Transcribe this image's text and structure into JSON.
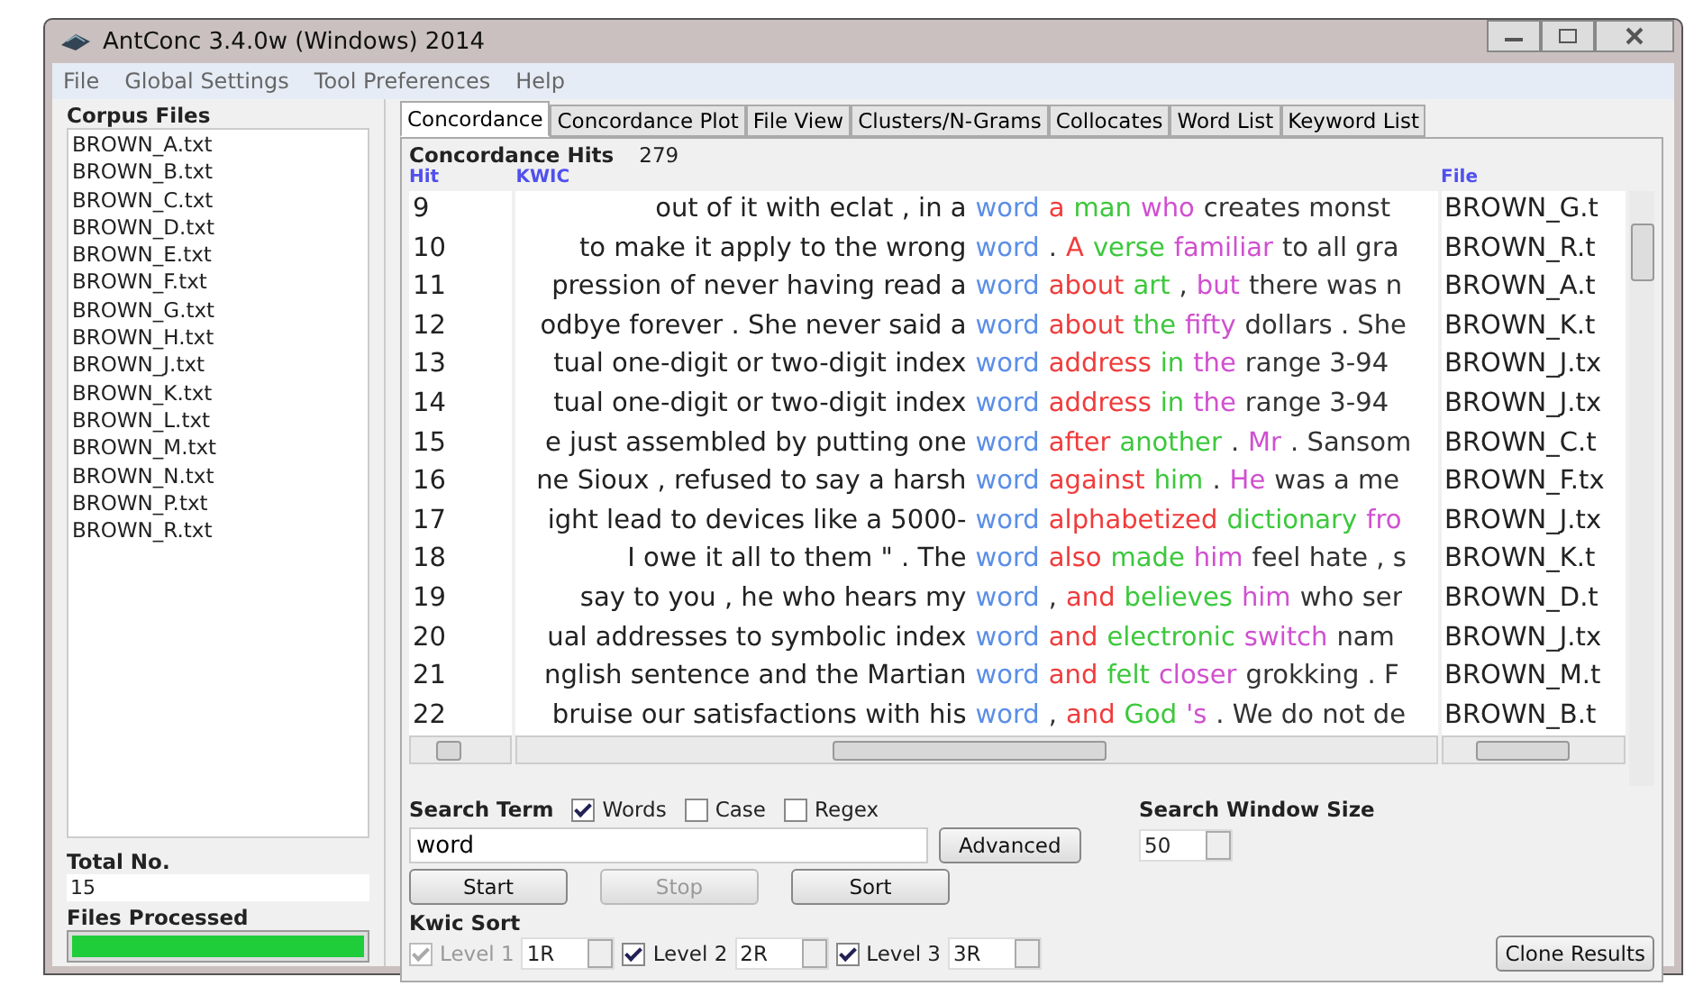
{
  "window": {
    "title": "AntConc 3.4.0w (Windows) 2014"
  },
  "menu": [
    "File",
    "Global Settings",
    "Tool Preferences",
    "Help"
  ],
  "corpus": {
    "title": "Corpus Files",
    "files": [
      "BROWN_A.txt",
      "BROWN_B.txt",
      "BROWN_C.txt",
      "BROWN_D.txt",
      "BROWN_E.txt",
      "BROWN_F.txt",
      "BROWN_G.txt",
      "BROWN_H.txt",
      "BROWN_J.txt",
      "BROWN_K.txt",
      "BROWN_L.txt",
      "BROWN_M.txt",
      "BROWN_N.txt",
      "BROWN_P.txt",
      "BROWN_R.txt"
    ],
    "total_label": "Total No.",
    "total": "15",
    "processed_label": "Files Processed",
    "level": 1
  },
  "tabs": [
    {
      "label": "Concordance",
      "selected": true
    },
    {
      "label": "Concordance Plot",
      "selected": false
    },
    {
      "label": "File View",
      "selected": false
    },
    {
      "label": "Clusters/N-Grams",
      "selected": false
    },
    {
      "label": "Collocates",
      "selected": false
    },
    {
      "label": "Word List",
      "selected": false
    },
    {
      "label": "Keyword List",
      "selected": false
    }
  ],
  "hits": {
    "label": "Concordance Hits",
    "count": "279"
  },
  "columns": [
    "Hit",
    "KWIC",
    "File"
  ],
  "rows": [
    {
      "hit": "9",
      "left": "out of it with eclat , in a",
      "keyword": {
        "text": "word",
        "color": "#5b8ee6"
      },
      "right": [
        {
          "text": "a",
          "color": "#f03c3c"
        },
        {
          "text": "man",
          "color": "#3cc83c"
        },
        {
          "text": "who",
          "color": "#d050d0"
        },
        {
          "text": "creates monst",
          "color": "#333333"
        }
      ],
      "file": "BROWN_G.t"
    },
    {
      "hit": "10",
      "left": "to make it apply to the wrong",
      "keyword": {
        "text": "word",
        "color": "#5b8ee6"
      },
      "right": [
        {
          "text": ".",
          "color": "#333333"
        },
        {
          "text": "A",
          "color": "#f03c3c"
        },
        {
          "text": "verse",
          "color": "#3cc83c"
        },
        {
          "text": "familiar",
          "color": "#d050d0"
        },
        {
          "text": "to all gra",
          "color": "#333333"
        }
      ],
      "file": "BROWN_R.t"
    },
    {
      "hit": "11",
      "left": "pression of never having read a",
      "keyword": {
        "text": "word",
        "color": "#5b8ee6"
      },
      "right": [
        {
          "text": "about",
          "color": "#f03c3c"
        },
        {
          "text": "art",
          "color": "#3cc83c"
        },
        {
          "text": ",",
          "color": "#333333"
        },
        {
          "text": "but",
          "color": "#d050d0"
        },
        {
          "text": "there was n",
          "color": "#333333"
        }
      ],
      "file": "BROWN_A.t"
    },
    {
      "hit": "12",
      "left": "odbye forever . She never said a",
      "keyword": {
        "text": "word",
        "color": "#5b8ee6"
      },
      "right": [
        {
          "text": "about",
          "color": "#f03c3c"
        },
        {
          "text": "the",
          "color": "#3cc83c"
        },
        {
          "text": "fifty",
          "color": "#d050d0"
        },
        {
          "text": "dollars . She",
          "color": "#333333"
        }
      ],
      "file": "BROWN_K.t"
    },
    {
      "hit": "13",
      "left": "tual one-digit or two-digit index",
      "keyword": {
        "text": "word",
        "color": "#5b8ee6"
      },
      "right": [
        {
          "text": "address",
          "color": "#f03c3c"
        },
        {
          "text": "in",
          "color": "#3cc83c"
        },
        {
          "text": "the",
          "color": "#d050d0"
        },
        {
          "text": "range 3-94",
          "color": "#333333"
        }
      ],
      "file": "BROWN_J.tx"
    },
    {
      "hit": "14",
      "left": "tual one-digit or two-digit index",
      "keyword": {
        "text": "word",
        "color": "#5b8ee6"
      },
      "right": [
        {
          "text": "address",
          "color": "#f03c3c"
        },
        {
          "text": "in",
          "color": "#3cc83c"
        },
        {
          "text": "the",
          "color": "#d050d0"
        },
        {
          "text": "range 3-94",
          "color": "#333333"
        }
      ],
      "file": "BROWN_J.tx"
    },
    {
      "hit": "15",
      "left": "e just assembled by putting one",
      "keyword": {
        "text": "word",
        "color": "#5b8ee6"
      },
      "right": [
        {
          "text": "after",
          "color": "#f03c3c"
        },
        {
          "text": "another",
          "color": "#3cc83c"
        },
        {
          "text": ".",
          "color": "#333333"
        },
        {
          "text": "Mr",
          "color": "#d050d0"
        },
        {
          "text": ". Sansom",
          "color": "#333333"
        }
      ],
      "file": "BROWN_C.t"
    },
    {
      "hit": "16",
      "left": "ne Sioux , refused to say a harsh",
      "keyword": {
        "text": "word",
        "color": "#5b8ee6"
      },
      "right": [
        {
          "text": "against",
          "color": "#f03c3c"
        },
        {
          "text": "him",
          "color": "#3cc83c"
        },
        {
          "text": ".",
          "color": "#333333"
        },
        {
          "text": "He",
          "color": "#d050d0"
        },
        {
          "text": "was a me",
          "color": "#333333"
        }
      ],
      "file": "BROWN_F.tx"
    },
    {
      "hit": "17",
      "left": "ight lead to devices like a 5000-",
      "keyword": {
        "text": "word",
        "color": "#5b8ee6"
      },
      "right": [
        {
          "text": "alphabetized",
          "color": "#f03c3c"
        },
        {
          "text": "dictionary",
          "color": "#3cc83c"
        },
        {
          "text": "fro",
          "color": "#d050d0"
        }
      ],
      "file": "BROWN_J.tx"
    },
    {
      "hit": "18",
      "left": "I owe it all to them \" . The",
      "keyword": {
        "text": "word",
        "color": "#5b8ee6"
      },
      "right": [
        {
          "text": "also",
          "color": "#f03c3c"
        },
        {
          "text": "made",
          "color": "#3cc83c"
        },
        {
          "text": "him",
          "color": "#d050d0"
        },
        {
          "text": "feel hate , s",
          "color": "#333333"
        }
      ],
      "file": "BROWN_K.t"
    },
    {
      "hit": "19",
      "left": "say to you , he who hears my",
      "keyword": {
        "text": "word",
        "color": "#5b8ee6"
      },
      "right": [
        {
          "text": ",",
          "color": "#333333"
        },
        {
          "text": "and",
          "color": "#f03c3c"
        },
        {
          "text": "believes",
          "color": "#3cc83c"
        },
        {
          "text": "him",
          "color": "#d050d0"
        },
        {
          "text": "who ser",
          "color": "#333333"
        }
      ],
      "file": "BROWN_D.t"
    },
    {
      "hit": "20",
      "left": "ual addresses to symbolic index",
      "keyword": {
        "text": "word",
        "color": "#5b8ee6"
      },
      "right": [
        {
          "text": "and",
          "color": "#f03c3c"
        },
        {
          "text": "electronic",
          "color": "#3cc83c"
        },
        {
          "text": "switch",
          "color": "#d050d0"
        },
        {
          "text": "nam",
          "color": "#333333"
        }
      ],
      "file": "BROWN_J.tx"
    },
    {
      "hit": "21",
      "left": "nglish sentence and the Martian",
      "keyword": {
        "text": "word",
        "color": "#5b8ee6"
      },
      "right": [
        {
          "text": "and",
          "color": "#f03c3c"
        },
        {
          "text": "felt",
          "color": "#3cc83c"
        },
        {
          "text": "closer",
          "color": "#d050d0"
        },
        {
          "text": "grokking . F",
          "color": "#333333"
        }
      ],
      "file": "BROWN_M.t"
    },
    {
      "hit": "22",
      "left": "bruise our satisfactions with his",
      "keyword": {
        "text": "word",
        "color": "#5b8ee6"
      },
      "right": [
        {
          "text": ",",
          "color": "#333333"
        },
        {
          "text": "and",
          "color": "#f03c3c"
        },
        {
          "text": "God",
          "color": "#3cc83c"
        },
        {
          "text": "'s",
          "color": "#d050d0"
        },
        {
          "text": ". We do not de",
          "color": "#333333"
        }
      ],
      "file": "BROWN_B.t"
    }
  ],
  "search": {
    "label": "Search Term",
    "options": [
      {
        "label": "Words",
        "checked": true
      },
      {
        "label": "Case",
        "checked": false
      },
      {
        "label": "Regex",
        "checked": false
      }
    ],
    "value": "word",
    "advanced": "Advanced",
    "window_label": "Search Window Size",
    "window_size": "50"
  },
  "buttons": [
    {
      "label": "Start",
      "disabled": false
    },
    {
      "label": "Stop",
      "disabled": true
    },
    {
      "label": "Sort",
      "disabled": false
    }
  ],
  "sort": {
    "label": "Kwic Sort",
    "levels": [
      {
        "label": "Level 1",
        "value": "1R",
        "checked": true,
        "disabled": true
      },
      {
        "label": "Level 2",
        "value": "2R",
        "checked": true,
        "disabled": false
      },
      {
        "label": "Level 3",
        "value": "3R",
        "checked": true,
        "disabled": false
      }
    ]
  },
  "clone": "Clone Results"
}
